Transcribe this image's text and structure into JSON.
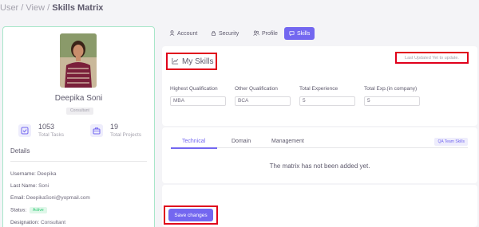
{
  "breadcrumb": {
    "parent1": "User /",
    "parent2": "View /",
    "current": "Skills Matrix"
  },
  "profile": {
    "name": "Deepika Soni",
    "role": "Consultant",
    "stats": [
      {
        "value": "1053",
        "label": "Total Tasks",
        "icon": "check-square-icon"
      },
      {
        "value": "19",
        "label": "Total Projects",
        "icon": "briefcase-icon"
      }
    ],
    "details_title": "Details",
    "details": [
      {
        "label": "Username:",
        "value": "Deepika"
      },
      {
        "label": "Last Name:",
        "value": "Soni"
      },
      {
        "label": "Email:",
        "value": "DeepikaSoni@yopmail.com"
      },
      {
        "label": "Status:",
        "value": "Active"
      },
      {
        "label": "Designation:",
        "value": "Consultant"
      }
    ]
  },
  "tabs": [
    {
      "label": "Account",
      "icon": "user-icon"
    },
    {
      "label": "Security",
      "icon": "lock-icon"
    },
    {
      "label": "Profile",
      "icon": "users-icon"
    },
    {
      "label": "Skills",
      "icon": "skills-icon",
      "active": true
    }
  ],
  "skills": {
    "title": "My Skills",
    "last_updated": "Last Updated Yet to update.",
    "fields": [
      {
        "label": "Highest Qualification",
        "value": "MBA"
      },
      {
        "label": "Other Qualification",
        "value": "BCA"
      },
      {
        "label": "Total Experience",
        "value": "5"
      },
      {
        "label": "Total Exp.(in company)",
        "value": "5"
      }
    ]
  },
  "matrix": {
    "tabs": [
      "Technical",
      "Domain",
      "Management"
    ],
    "active_tab": "Technical",
    "badge": "QA Team Skills",
    "empty_message": "The matrix has not been added yet."
  },
  "save_label": "Save changes",
  "colors": {
    "primary": "#7367f0",
    "highlight": "#e0001b",
    "success": "#28c76f",
    "card_border": "#a8e6c9"
  }
}
